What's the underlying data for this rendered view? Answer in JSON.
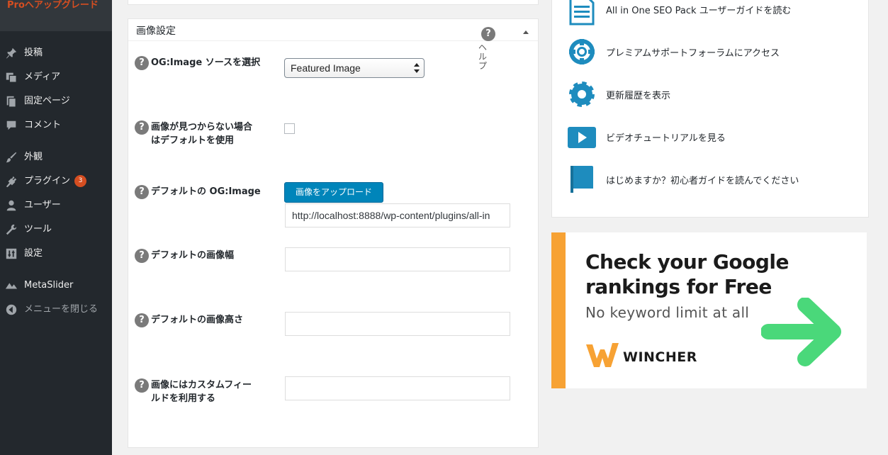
{
  "sidebar": {
    "upgrade_label": "Proへアップグレード",
    "items": [
      {
        "label": "投稿",
        "icon": "pushpin-icon"
      },
      {
        "label": "メディア",
        "icon": "media-icon"
      },
      {
        "label": "固定ページ",
        "icon": "pages-icon"
      },
      {
        "label": "コメント",
        "icon": "comment-icon"
      },
      {
        "label": "外観",
        "icon": "brush-icon"
      },
      {
        "label": "プラグイン",
        "icon": "plugin-icon",
        "badge": "3"
      },
      {
        "label": "ユーザー",
        "icon": "user-icon"
      },
      {
        "label": "ツール",
        "icon": "wrench-icon"
      },
      {
        "label": "設定",
        "icon": "settings-icon"
      },
      {
        "label": "MetaSlider",
        "icon": "metaslider-icon"
      },
      {
        "label": "メニューを閉じる",
        "icon": "collapse-icon"
      }
    ]
  },
  "image_settings": {
    "title": "画像設定",
    "help_label": "ヘルプ",
    "fields": {
      "og_source": {
        "label": "OG:Image ソースを選択",
        "value": "Featured Image"
      },
      "fallback": {
        "label_line1": "画像が見つからない場合",
        "label_line2": "はデフォルトを使用",
        "checked": false
      },
      "default_image": {
        "label": "デフォルトの OG:Image",
        "upload_label": "画像をアップロード",
        "value": "http://localhost:8888/wp-content/plugins/all-in"
      },
      "default_width": {
        "label": "デフォルトの画像幅",
        "value": ""
      },
      "default_height": {
        "label": "デフォルトの画像高さ",
        "value": ""
      },
      "custom_field": {
        "label_line1": "画像にはカスタムフィー",
        "label_line2": "ルドを利用する",
        "value": ""
      }
    }
  },
  "resources": [
    {
      "label": "All in One SEO Pack ユーザーガイドを読む",
      "icon": "document-icon"
    },
    {
      "label": "プレミアムサポートフォーラムにアクセス",
      "icon": "lifebuoy-icon"
    },
    {
      "label": "更新履歴を表示",
      "icon": "gear-icon"
    },
    {
      "label": "ビデオチュートリアルを見る",
      "icon": "play-icon"
    },
    {
      "label": "はじめますか？初心者ガイドを読んでください",
      "icon": "book-icon"
    }
  ],
  "ad": {
    "headline_line1": "Check your Google",
    "headline_line2": "rankings for Free",
    "subline": "No keyword limit at all",
    "brand": "WINCHER",
    "colors": {
      "accent": "#f7a234",
      "arrow": "#4ad87a",
      "brand_logo": "#f7a234"
    }
  },
  "colors": {
    "sidebar_bg": "#23282d",
    "upgrade_text": "#d54e21",
    "primary_button": "#0085ba",
    "resource_icon": "#1e8cbe"
  }
}
